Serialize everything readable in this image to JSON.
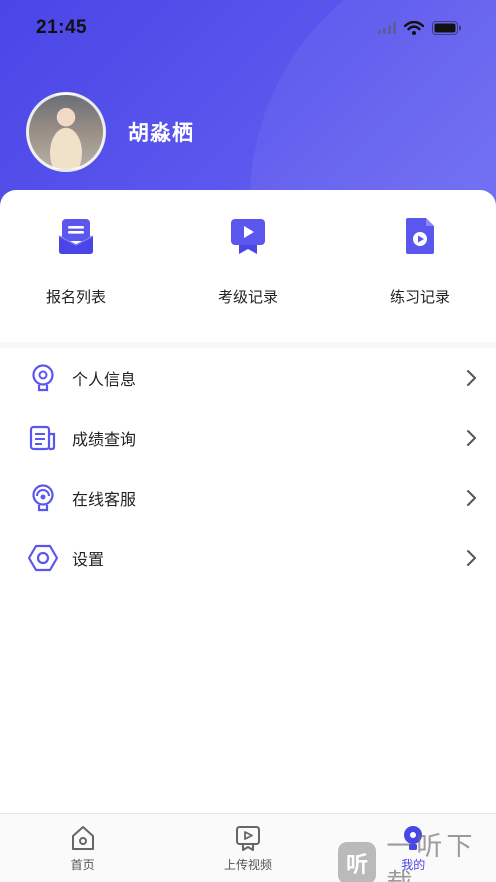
{
  "status_bar": {
    "time": "21:45"
  },
  "profile": {
    "username": "胡淼栖"
  },
  "quick_actions": [
    {
      "label": "报名列表",
      "icon": "envelope-list-icon"
    },
    {
      "label": "考级记录",
      "icon": "video-play-ribbon-icon"
    },
    {
      "label": "练习记录",
      "icon": "video-file-icon"
    }
  ],
  "menu": [
    {
      "label": "个人信息",
      "icon": "lightbulb-icon"
    },
    {
      "label": "成绩查询",
      "icon": "document-list-icon"
    },
    {
      "label": "在线客服",
      "icon": "headset-icon"
    },
    {
      "label": "设置",
      "icon": "hexagon-gear-icon"
    }
  ],
  "tabbar": [
    {
      "label": "首页",
      "icon": "home-icon",
      "active": false
    },
    {
      "label": "上传视频",
      "icon": "upload-video-icon",
      "active": false
    },
    {
      "label": "我的",
      "icon": "profile-bulb-icon",
      "active": true
    }
  ],
  "watermark": {
    "logo": "听",
    "text": "一听下载"
  },
  "colors": {
    "accent": "#4a45e6",
    "accent_light": "#6d6bf3",
    "icon_stroke": "#5b57ee"
  }
}
